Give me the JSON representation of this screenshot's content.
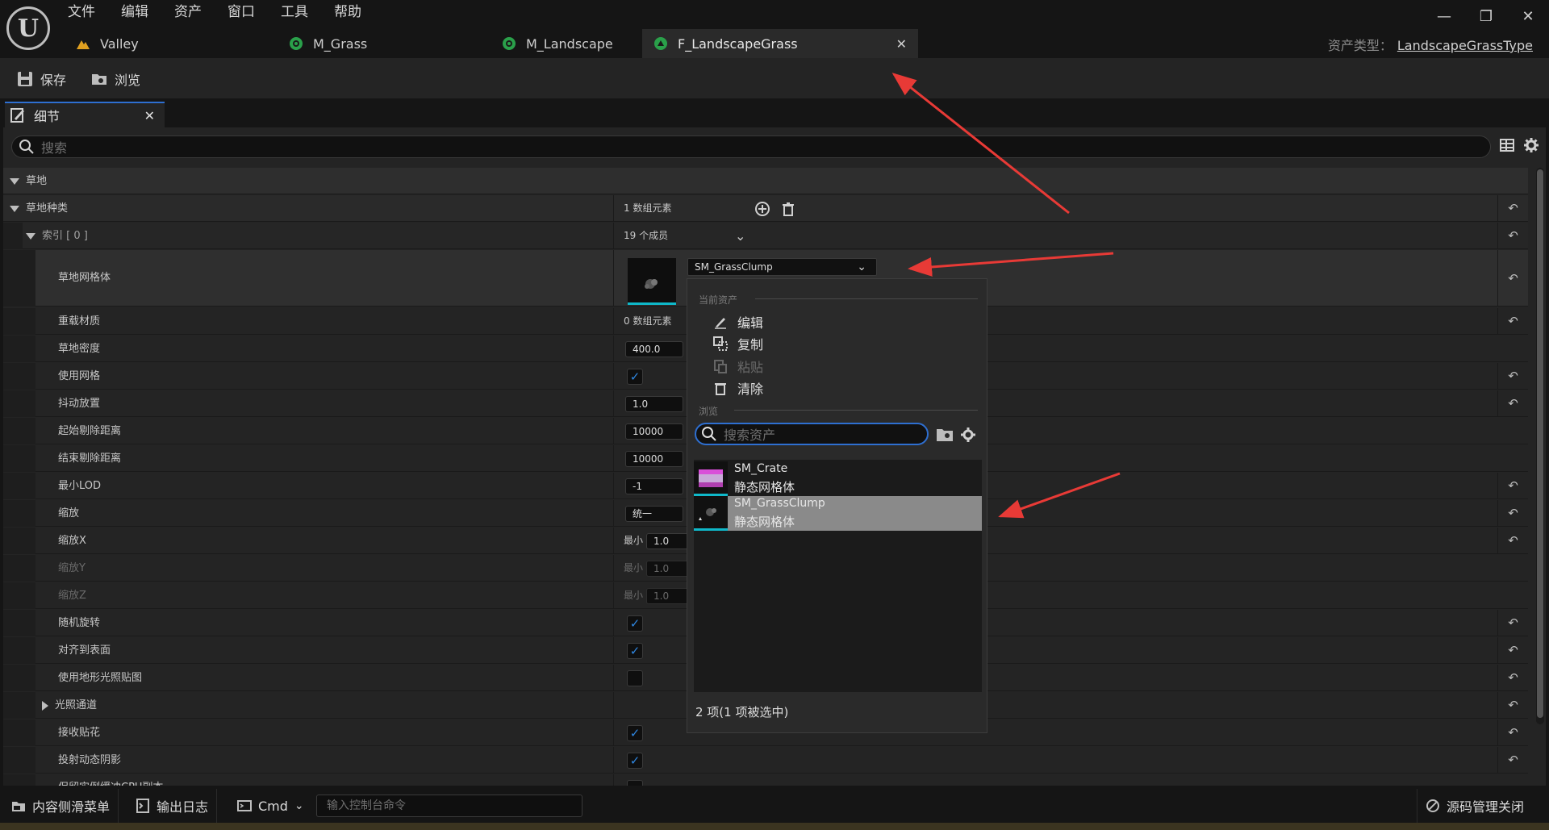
{
  "menu": [
    "文件",
    "编辑",
    "资产",
    "窗口",
    "工具",
    "帮助"
  ],
  "tabs": [
    {
      "label": "Valley",
      "icon": "landscape-icon"
    },
    {
      "label": "M_Grass",
      "icon": "material-icon"
    },
    {
      "label": "M_Landscape",
      "icon": "material-icon"
    },
    {
      "label": "F_LandscapeGrass",
      "icon": "grass-type-icon",
      "active": true
    }
  ],
  "asset_type": {
    "label": "资产类型：",
    "value": "LandscapeGrassType"
  },
  "toolbar": {
    "save": "保存",
    "browse": "浏览"
  },
  "panel": {
    "tab": "细节",
    "search_placeholder": "搜索"
  },
  "props": {
    "cat": "草地",
    "grass_varieties": {
      "label": "草地种类",
      "value": "1 数组元素"
    },
    "index0": {
      "label": "索引 [ 0 ]",
      "value": "19 个成员"
    },
    "grass_mesh": {
      "label": "草地网格体",
      "value": "SM_GrassClump"
    },
    "override_materials": {
      "label": "重载材质",
      "value": "0 数组元素"
    },
    "grass_density": {
      "label": "草地密度",
      "value": "400.0"
    },
    "use_grid": {
      "label": "使用网格"
    },
    "placement_jitter": {
      "label": "抖动放置",
      "value": "1.0"
    },
    "start_cull": {
      "label": "起始剔除距离",
      "value": "10000"
    },
    "end_cull": {
      "label": "结束剔除距离",
      "value": "10000"
    },
    "min_lod": {
      "label": "最小LOD",
      "value": "-1"
    },
    "scaling": {
      "label": "缩放",
      "value": "统一"
    },
    "scale_x": {
      "label": "缩放X",
      "min": "最小",
      "value": "1.0"
    },
    "scale_y": {
      "label": "缩放Y",
      "min": "最小",
      "value": "1.0"
    },
    "scale_z": {
      "label": "缩放Z",
      "min": "最小",
      "value": "1.0"
    },
    "random_rotation": {
      "label": "随机旋转"
    },
    "align_to_surface": {
      "label": "对齐到表面"
    },
    "use_landscape_lightmap": {
      "label": "使用地形光照贴图"
    },
    "lighting_channels": {
      "label": "光照通道"
    },
    "receives_decals": {
      "label": "接收贴花"
    },
    "cast_dynamic_shadow": {
      "label": "投射动态阴影"
    },
    "keep_cpu_copy": {
      "label": "保留实例缓冲CPU副本"
    }
  },
  "popup": {
    "current_asset": "当前资产",
    "edit": "编辑",
    "copy": "复制",
    "paste": "粘贴",
    "clear": "清除",
    "browse": "浏览",
    "search_placeholder": "搜索资产",
    "items": [
      {
        "name": "SM_Crate",
        "type": "静态网格体"
      },
      {
        "name": "SM_GrassClump",
        "type": "静态网格体",
        "selected": true
      }
    ],
    "footer": "2 项(1 项被选中)"
  },
  "status": {
    "content_drawer": "内容侧滑菜单",
    "output_log": "输出日志",
    "cmd": "Cmd",
    "console_placeholder": "输入控制台命令",
    "source_control": "源码管理关闭"
  },
  "colors": {
    "accent": "#2e6fd1",
    "check": "#2f86e0",
    "thumb_underline": "#0fb8c9",
    "arrow": "#e83a36"
  }
}
